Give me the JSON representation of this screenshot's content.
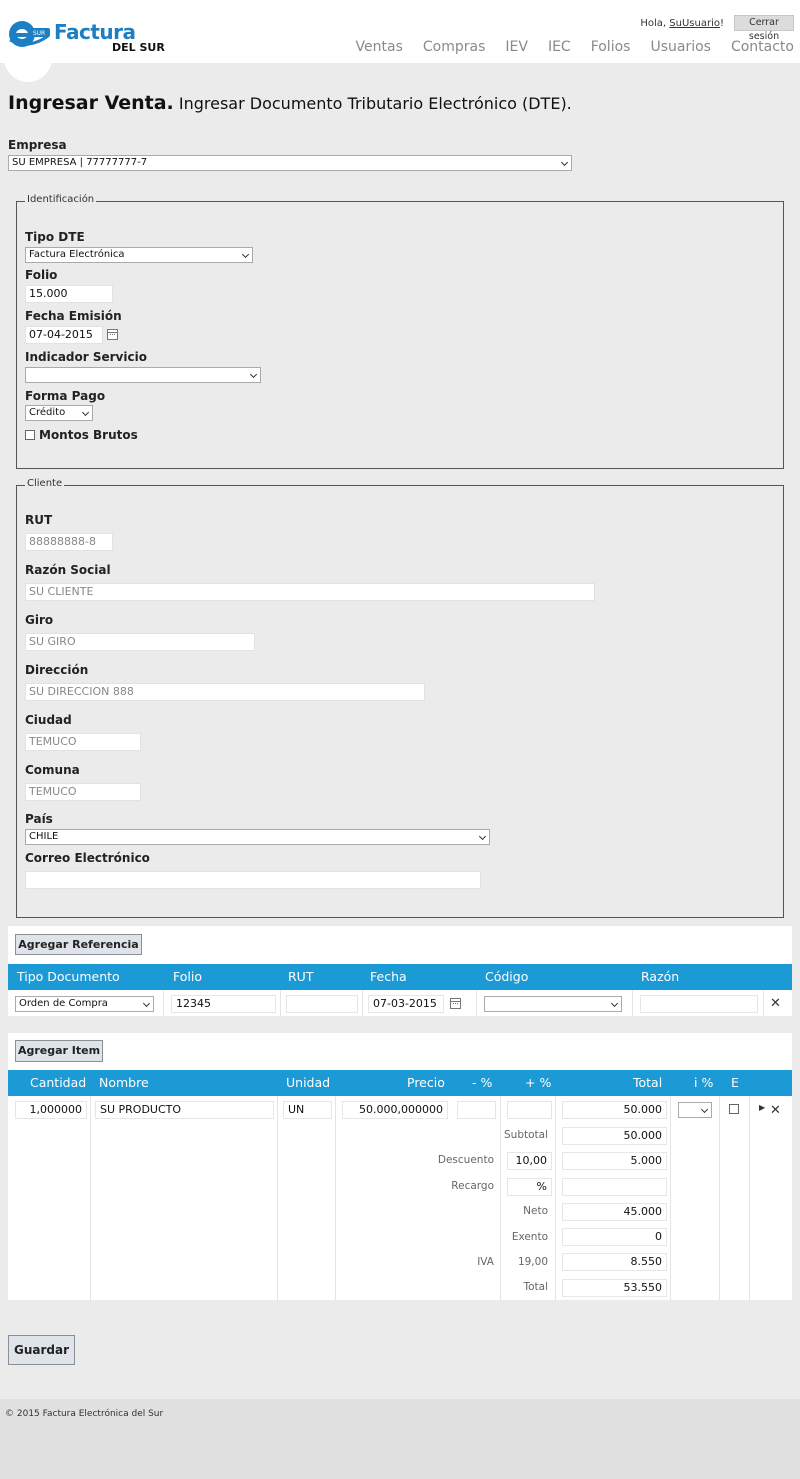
{
  "brand": {
    "name": "Factura",
    "sub": "DEL SUR",
    "badge": "SUR"
  },
  "header": {
    "greeting": "Hola, ",
    "user": "SuUsuario",
    "greeting_end": "!",
    "logout": "Cerrar sesión",
    "nav": [
      "Ventas",
      "Compras",
      "IEV",
      "IEC",
      "Folios",
      "Usuarios",
      "Contacto"
    ]
  },
  "title": {
    "bold": "Ingresar Venta.",
    "sub": "Ingresar Documento Tributario Electrónico (DTE)."
  },
  "empresa": {
    "label": "Empresa",
    "value": "SU EMPRESA | 77777777-7"
  },
  "identificacion": {
    "legend": "Identificación",
    "tipo_label": "Tipo DTE",
    "tipo_value": "Factura Electrónica",
    "folio_label": "Folio",
    "folio_value": "15.000",
    "fecha_label": "Fecha Emisión",
    "fecha_value": "07-04-2015",
    "indicador_label": "Indicador Servicio",
    "indicador_value": "",
    "forma_label": "Forma Pago",
    "forma_value": "Crédito",
    "montos_label": "Montos Brutos"
  },
  "cliente": {
    "legend": "Cliente",
    "rut_label": "RUT",
    "rut_ph": "88888888-8",
    "razon_label": "Razón Social",
    "razon_ph": "SU CLIENTE",
    "giro_label": "Giro",
    "giro_ph": "SU GIRO",
    "direccion_label": "Dirección",
    "direccion_ph": "SU DIRECCION 888",
    "ciudad_label": "Ciudad",
    "ciudad_ph": "TEMUCO",
    "comuna_label": "Comuna",
    "comuna_ph": "TEMUCO",
    "pais_label": "País",
    "pais_value": "CHILE",
    "correo_label": "Correo Electrónico",
    "correo_value": ""
  },
  "referencias": {
    "button": "Agregar Referencia",
    "headers": [
      "Tipo Documento",
      "Folio",
      "RUT",
      "Fecha",
      "Código",
      "Razón"
    ],
    "row": {
      "tipo": "Orden de Compra",
      "folio": "12345",
      "rut": "",
      "fecha": "07-03-2015",
      "codigo": "",
      "razon": ""
    }
  },
  "items": {
    "button": "Agregar Item",
    "headers": [
      "Cantidad",
      "Nombre",
      "Unidad",
      "Precio",
      "- %",
      "+ %",
      "Total",
      "i %",
      "E"
    ],
    "row": {
      "cantidad": "1,000000",
      "nombre": "SU PRODUCTO",
      "unidad": "UN",
      "precio": "50.000,000000",
      "desc": "",
      "rec": "",
      "total": "50.000"
    },
    "summary": {
      "subtotal_label": "Subtotal",
      "subtotal": "50.000",
      "descuento_label": "Descuento",
      "descuento_pct": "10,00",
      "descuento": "5.000",
      "recargo_label": "Recargo",
      "recargo_pct": "%",
      "recargo": "",
      "neto_label": "Neto",
      "neto": "45.000",
      "exento_label": "Exento",
      "exento": "0",
      "iva_label": "IVA",
      "iva_pct": "19,00",
      "iva": "8.550",
      "total_label": "Total",
      "total": "53.550"
    }
  },
  "save_button": "Guardar",
  "footer": "© 2015 Factura Electrónica del Sur",
  "colors": {
    "accent": "#1c9ad6",
    "brand": "#1c7fc4",
    "background": "#ebebeb"
  }
}
